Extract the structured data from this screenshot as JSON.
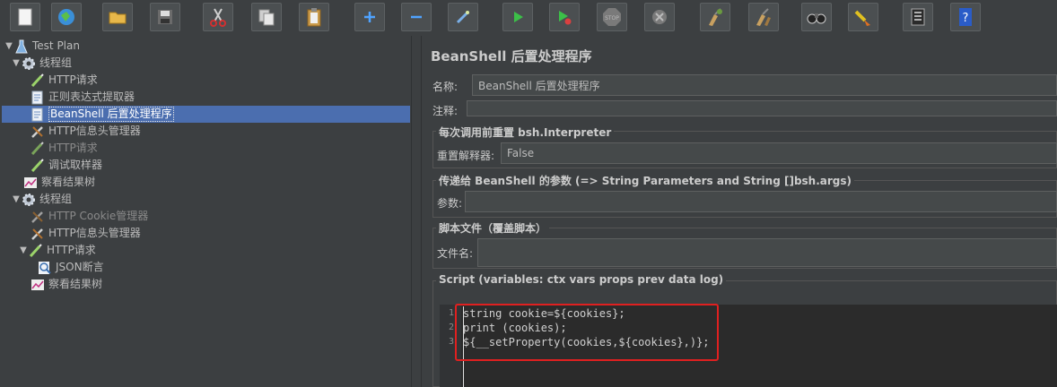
{
  "toolbar": {
    "buttons": [
      {
        "name": "new-icon"
      },
      {
        "name": "templates-icon"
      },
      {
        "name": "open-icon"
      },
      {
        "name": "save-icon"
      },
      {
        "name": "cut-icon"
      },
      {
        "name": "copy-icon"
      },
      {
        "name": "paste-icon"
      },
      {
        "name": "expand-icon"
      },
      {
        "name": "collapse-icon"
      },
      {
        "name": "toggle-icon"
      },
      {
        "name": "start-icon"
      },
      {
        "name": "start-no-pauses-icon"
      },
      {
        "name": "stop-icon"
      },
      {
        "name": "shutdown-icon"
      },
      {
        "name": "clear-icon"
      },
      {
        "name": "clear-all-icon"
      },
      {
        "name": "search-icon"
      },
      {
        "name": "reset-search-icon"
      },
      {
        "name": "function-helper-icon"
      },
      {
        "name": "help-icon"
      }
    ]
  },
  "tree": {
    "items": [
      {
        "label": "Test Plan",
        "icon": "test-plan-icon"
      },
      {
        "label": "线程组",
        "icon": "thread-group-icon"
      },
      {
        "label": "HTTP请求",
        "icon": "sampler-icon"
      },
      {
        "label": "正则表达式提取器",
        "icon": "post-processor-icon"
      },
      {
        "label": "BeanShell 后置处理程序",
        "icon": "post-processor-icon"
      },
      {
        "label": "HTTP信息头管理器",
        "icon": "config-icon"
      },
      {
        "label": "HTTP请求",
        "icon": "sampler-icon"
      },
      {
        "label": "调试取样器",
        "icon": "sampler-icon"
      },
      {
        "label": "察看结果树",
        "icon": "listener-icon"
      },
      {
        "label": "线程组",
        "icon": "thread-group-icon"
      },
      {
        "label": "HTTP Cookie管理器",
        "icon": "config-icon"
      },
      {
        "label": "HTTP信息头管理器",
        "icon": "config-icon"
      },
      {
        "label": "HTTP请求",
        "icon": "sampler-icon"
      },
      {
        "label": "JSON断言",
        "icon": "assertion-icon"
      },
      {
        "label": "察看结果树",
        "icon": "listener-icon"
      }
    ]
  },
  "panel": {
    "title": "BeanShell 后置处理程序",
    "name_label": "名称:",
    "name_value": "BeanShell 后置处理程序",
    "comment_label": "注释:",
    "comment_value": "",
    "reset_group_title": "每次调用前重置 bsh.Interpreter",
    "reset_label": "重置解释器:",
    "reset_value": "False",
    "params_group_title": "传递给 BeanShell 的参数 (=> String Parameters and String []bsh.args)",
    "params_label": "参数:",
    "params_value": "",
    "file_group_title": "脚本文件（覆盖脚本）",
    "file_label": "文件名:",
    "file_value": "",
    "script_group_title": "Script (variables: ctx vars props prev data log)",
    "line_numbers": [
      "1",
      "2",
      "3"
    ],
    "code_lines": [
      "string cookie=${cookies};",
      "print (cookies);",
      "${__setProperty(cookies,${cookies},)};"
    ]
  },
  "colors": {
    "background": "#3c3f41",
    "selection": "#4b6eaf",
    "highlight_box": "#e02020"
  }
}
